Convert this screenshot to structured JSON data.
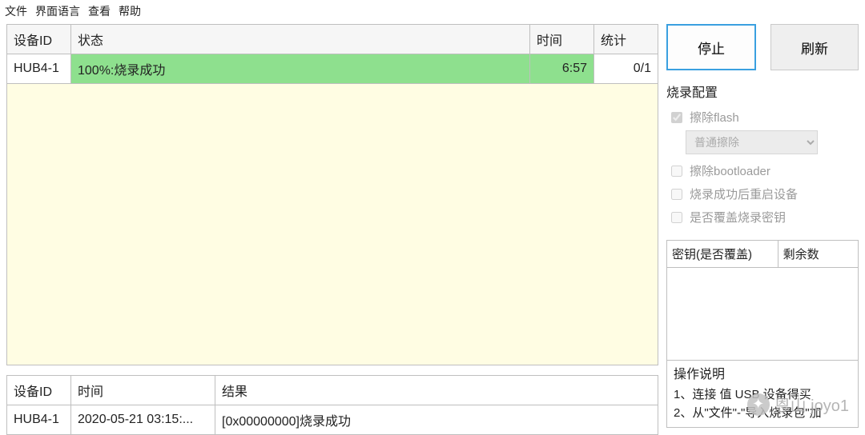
{
  "menu": {
    "file": "文件",
    "lang": "界面语言",
    "view": "查看",
    "help": "帮助"
  },
  "table": {
    "headers": {
      "id": "设备ID",
      "status": "状态",
      "time": "时间",
      "stat": "统计"
    },
    "rows": [
      {
        "id": "HUB4-1",
        "status": "100%:烧录成功",
        "time": "6:57",
        "stat": "0/1"
      }
    ]
  },
  "log": {
    "headers": {
      "id": "设备ID",
      "time": "时间",
      "result": "结果"
    },
    "rows": [
      {
        "id": "HUB4-1",
        "time": "2020-05-21 03:15:...",
        "result": "[0x00000000]烧录成功"
      }
    ]
  },
  "buttons": {
    "stop": "停止",
    "refresh": "刷新"
  },
  "config": {
    "title": "烧录配置",
    "erase_flash": "擦除flash",
    "erase_mode": "普通擦除",
    "erase_bootloader": "擦除bootloader",
    "reboot": "烧录成功后重启设备",
    "overwrite_key": "是否覆盖烧录密钥"
  },
  "keys": {
    "col1": "密钥(是否覆盖)",
    "col2": "剩余数"
  },
  "helpbox": {
    "title": "操作说明",
    "line1": "1、连接 值 USB 设备得买",
    "line2": "2、从\"文件\"-\"导入烧录包\"加"
  },
  "watermark": "恩山 joyo1"
}
